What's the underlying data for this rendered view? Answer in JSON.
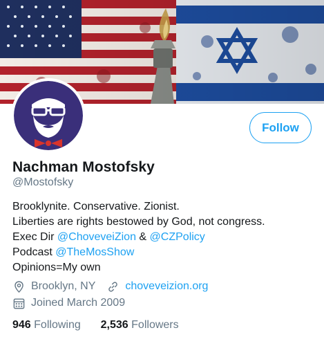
{
  "profile": {
    "name": "Nachman Mostofsky",
    "handle": "@Mostofsky",
    "follow_label": "Follow",
    "bio": {
      "line1": "Brooklynite. Conservative. Zionist.",
      "line2": "Liberties are rights bestowed by God, not congress.",
      "line3_prefix": "Exec Dir ",
      "line3_link1": "@ChoveveiZion",
      "line3_mid": " & ",
      "line3_link2": "@CZPolicy",
      "line4_prefix": "Podcast ",
      "line4_link": "@TheMosShow",
      "line5": "Opinions=My own"
    },
    "location": "Brooklyn, NY",
    "website": "choveveizion.org",
    "joined": "Joined March 2009",
    "following_count": "946",
    "following_label": "Following",
    "followers_count": "2,536",
    "followers_label": "Followers"
  },
  "icons": {
    "location": "location-pin-icon",
    "link": "link-icon",
    "calendar": "calendar-icon"
  },
  "colors": {
    "accent": "#1da1f2",
    "secondary_text": "#657786",
    "primary_text": "#14171a",
    "avatar_bg": "#3a2f7a",
    "bowtie": "#d9342b"
  }
}
